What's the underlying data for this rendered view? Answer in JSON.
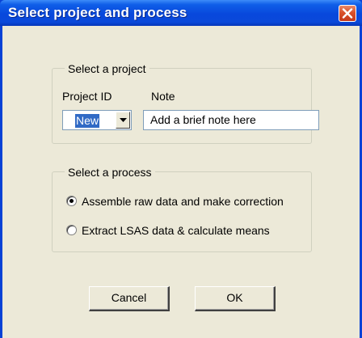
{
  "window": {
    "title": "Select project and process"
  },
  "project_group": {
    "legend": "Select a project",
    "project_id_label": "Project ID",
    "note_label": "Note",
    "project_id_value": "New",
    "note_value": "Add a brief note here"
  },
  "process_group": {
    "legend": "Select a process",
    "options": [
      {
        "label": "Assemble raw data and make correction",
        "selected": true
      },
      {
        "label": "Extract LSAS data & calculate means",
        "selected": false
      }
    ]
  },
  "buttons": {
    "cancel_label": "Cancel",
    "ok_label": "OK"
  },
  "colors": {
    "titlebar": "#0a49da",
    "client_background": "#ece9d8",
    "close_button": "#d9512a",
    "selection_highlight": "#316ac5"
  },
  "icons": {
    "close": "close-icon",
    "dropdown": "chevron-down-icon"
  }
}
